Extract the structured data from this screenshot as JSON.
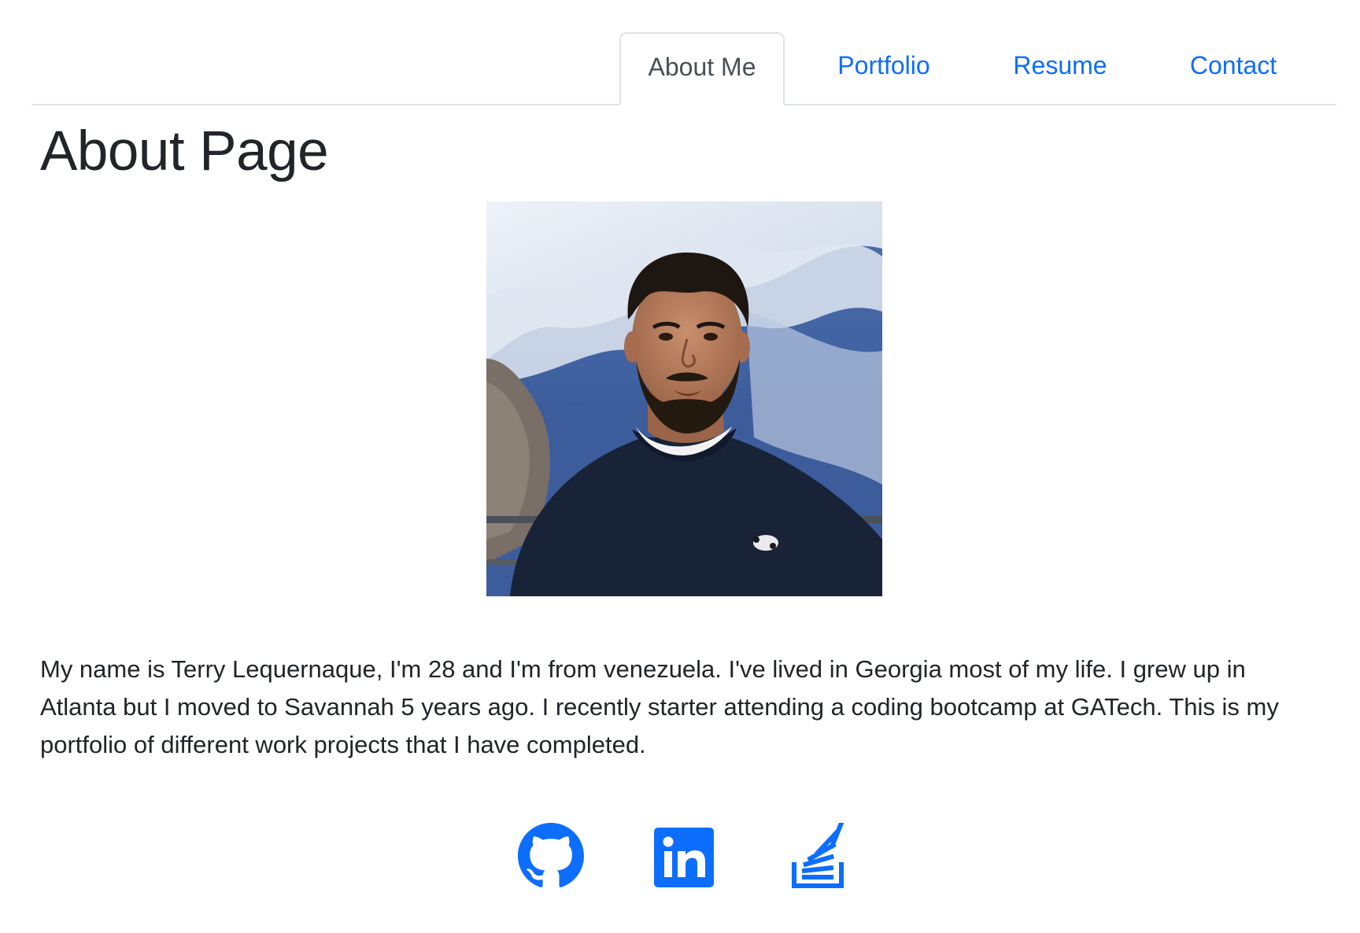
{
  "nav": {
    "tabs": [
      {
        "label": "About Me",
        "active": true
      },
      {
        "label": "Portfolio",
        "active": false
      },
      {
        "label": "Resume",
        "active": false
      },
      {
        "label": "Contact",
        "active": false
      }
    ]
  },
  "main": {
    "title": "About Page",
    "photo_alt": "profile-photo",
    "bio": "My name is Terry Lequernaque, I'm 28 and I'm from venezuela. I've lived in Georgia most of my life. I grew up in Atlanta but I moved to Savannah 5 years ago. I recently starter attending a coding bootcamp at GATech. This is my portfolio of different work projects that I have completed."
  },
  "socials": [
    {
      "icon": "github-icon"
    },
    {
      "icon": "linkedin-icon"
    },
    {
      "icon": "stackoverflow-icon"
    }
  ],
  "colors": {
    "accent": "#0d6efd",
    "text": "#212529",
    "tab_active_text": "#495057",
    "border": "#dee2e6"
  }
}
